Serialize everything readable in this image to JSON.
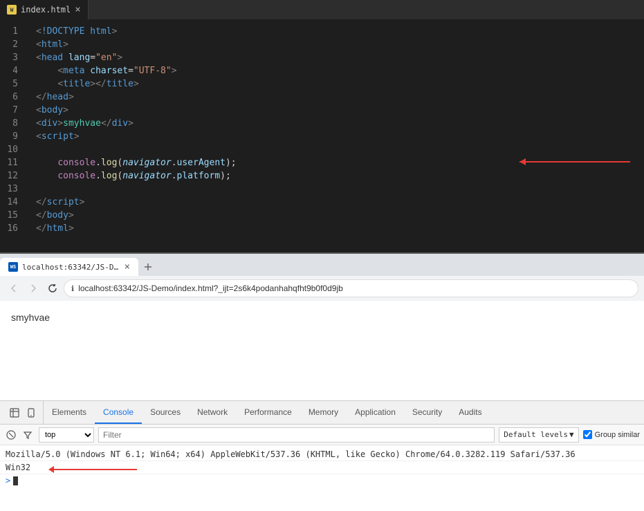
{
  "editor": {
    "tab": {
      "label": "index.html",
      "icon": "WS"
    },
    "lines": [
      1,
      2,
      3,
      4,
      5,
      6,
      7,
      8,
      9,
      10,
      11,
      12,
      13,
      14,
      15,
      16
    ]
  },
  "browser": {
    "tab": {
      "icon": "WS",
      "title": "localhost:63342/JS-De...",
      "close": "×"
    },
    "new_tab_icon": "+",
    "nav": {
      "back": "‹",
      "forward": "›",
      "refresh": "↻"
    },
    "url": "localhost:63342/JS-Demo/index.html?_ijt=2s6k4podanhahqfht9b0f0d9jb",
    "url_protocol": "localhost:",
    "page_content": "smyhvae"
  },
  "devtools": {
    "tabs": [
      {
        "label": "Elements",
        "active": false
      },
      {
        "label": "Console",
        "active": true
      },
      {
        "label": "Sources",
        "active": false
      },
      {
        "label": "Network",
        "active": false
      },
      {
        "label": "Performance",
        "active": false
      },
      {
        "label": "Memory",
        "active": false
      },
      {
        "label": "Application",
        "active": false
      },
      {
        "label": "Security",
        "active": false
      },
      {
        "label": "Audits",
        "active": false
      }
    ],
    "toolbar": {
      "context": "top",
      "filter_placeholder": "Filter",
      "levels_label": "Default levels",
      "group_similar_label": "Group similar"
    },
    "console_output": [
      {
        "text": "Mozilla/5.0 (Windows NT 6.1; Win64; x64) AppleWebKit/537.36 (KHTML, like Gecko) Chrome/64.0.3282.119 Safari/537.36",
        "continuation": "Win32"
      }
    ],
    "prompt_symbol": ">"
  }
}
